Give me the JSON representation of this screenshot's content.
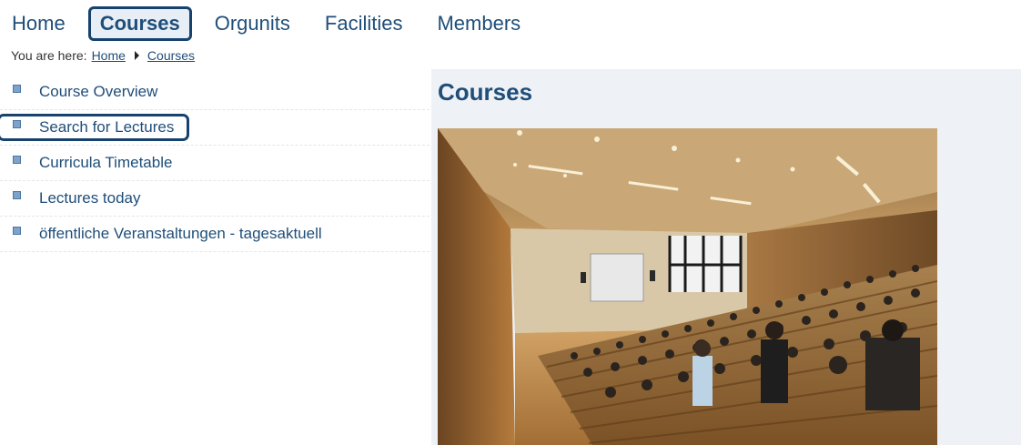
{
  "topnav": {
    "items": [
      {
        "label": "Home",
        "active": false
      },
      {
        "label": "Courses",
        "active": true
      },
      {
        "label": "Orgunits",
        "active": false
      },
      {
        "label": "Facilities",
        "active": false
      },
      {
        "label": "Members",
        "active": false
      }
    ]
  },
  "breadcrumb": {
    "prefix": "You are here:",
    "items": [
      "Home",
      "Courses"
    ]
  },
  "leftmenu": {
    "items": [
      {
        "label": "Course Overview",
        "selected": false
      },
      {
        "label": "Search for Lectures",
        "selected": true
      },
      {
        "label": "Curricula Timetable",
        "selected": false
      },
      {
        "label": "Lectures today",
        "selected": false
      },
      {
        "label": "öffentliche Veranstaltungen - tagesaktuell",
        "selected": false
      }
    ]
  },
  "content": {
    "title": "Courses",
    "image_icon": "lecture-hall-photo"
  },
  "colors": {
    "link": "#1f4e79",
    "highlight_border": "#17426e",
    "panel_bg": "#eef1f5"
  }
}
